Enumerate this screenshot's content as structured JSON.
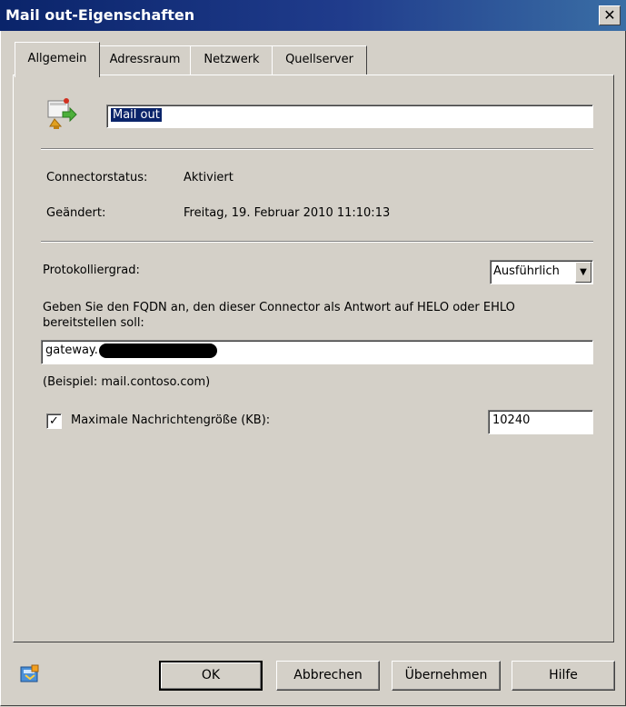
{
  "window": {
    "title": "Mail out-Eigenschaften",
    "close_symbol": "✕"
  },
  "tabs": [
    {
      "label": "Allgemein",
      "active": true
    },
    {
      "label": "Adressraum",
      "active": false
    },
    {
      "label": "Netzwerk",
      "active": false
    },
    {
      "label": "Quellserver",
      "active": false
    }
  ],
  "general": {
    "connector_icon": "send-connector-icon",
    "name_value": "Mail out",
    "status_label": "Connectorstatus:",
    "status_value": "Aktiviert",
    "changed_label": "Geändert:",
    "changed_value": "Freitag, 19. Februar 2010 11:10:13",
    "logging_label": "Protokolliergrad:",
    "logging_value": "Ausführlich",
    "fqdn_description": "Geben Sie den FQDN an, den dieser Connector als Antwort auf HELO oder EHLO bereitstellen soll:",
    "fqdn_value_prefix": "gateway.",
    "fqdn_example": "(Beispiel: mail.contoso.com)",
    "max_size_checked": true,
    "max_size_label": "Maximale Nachrichtengröße (KB):",
    "max_size_value": "10240"
  },
  "footer": {
    "help_icon": "exchange-help-icon",
    "ok_label": "OK",
    "cancel_label": "Abbrechen",
    "apply_label": "Übernehmen",
    "help_label": "Hilfe"
  },
  "colors": {
    "titlebar_start": "#0a246a",
    "titlebar_end": "#3a6ea5",
    "face": "#d4d0c8",
    "selection": "#0a246a"
  }
}
